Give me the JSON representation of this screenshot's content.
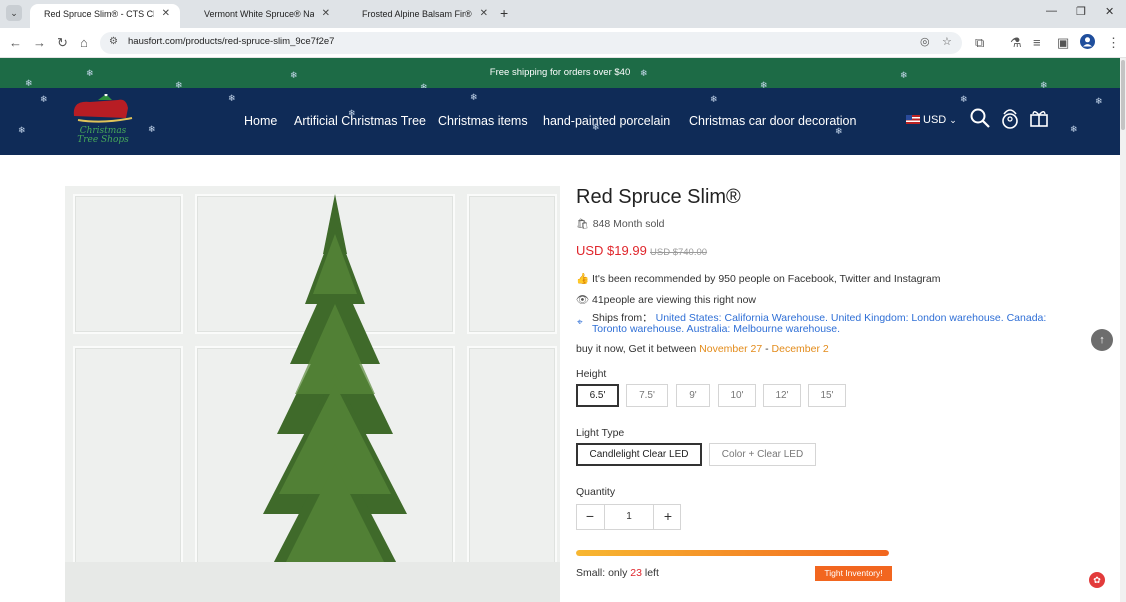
{
  "browser": {
    "tabs": [
      {
        "title": "Red Spruce Slim® - CTS Christ",
        "active": true
      },
      {
        "title": "Vermont White Spruce® Narro",
        "active": false
      },
      {
        "title": "Frosted Alpine Balsam Fir® Tre",
        "active": false
      }
    ],
    "tab_close": "✕",
    "new_tab": "+",
    "url": "hausfort.com/products/red-spruce-slim_9ce7f2e7",
    "icons": {
      "back": "←",
      "forward": "→",
      "reload": "↻",
      "home": "⌂",
      "minimize": "—",
      "maximize": "❐",
      "close": "✕",
      "menu": "⋮"
    }
  },
  "announcement": "Free shipping for orders over $40",
  "header": {
    "logo_text": "Christmas Tree Shops",
    "nav": [
      "Home",
      "Artificial Christmas Tree",
      "Christmas items",
      "hand-painted porcelain",
      "Christmas car door decoration"
    ],
    "currency": "USD"
  },
  "product": {
    "title": "Red Spruce Slim®",
    "sold": "848 Month sold",
    "price": "USD $19.99",
    "old_price": "USD $740.00",
    "recommend": "It's been recommended by 950 people on Facebook, Twitter and Instagram",
    "viewing": "41people are viewing this right now",
    "ships_label": "Ships from：",
    "ships_from": "United States: California Warehouse. United Kingdom: London warehouse. Canada: Toronto warehouse. Australia: Melbourne warehouse.",
    "eta_prefix": "buy it now,  Get it between ",
    "eta_start": "November 27",
    "eta_sep": " - ",
    "eta_end": "December 2",
    "height_label": "Height",
    "heights": [
      "6.5'",
      "7.5'",
      "9'",
      "10'",
      "12'",
      "15'"
    ],
    "selected_height": "6.5'",
    "light_label": "Light Type",
    "lights": [
      "Candlelight Clear LED",
      "Color + Clear LED"
    ],
    "selected_light": "Candlelight Clear LED",
    "quantity_label": "Quantity",
    "quantity": "1",
    "qty_minus": "−",
    "qty_plus": "+",
    "stock_fraction": 1.0,
    "stock_prefix": "Small: only ",
    "stock_count": "23",
    "stock_suffix": " left",
    "tight_label": "Tight Inventory!"
  },
  "colors": {
    "header_bg": "#0f2b57",
    "announce_bg": "#1d6b46",
    "price": "#e0262c",
    "link": "#2f6fd6",
    "date": "#e38b1a",
    "stock": "#f2661f"
  }
}
